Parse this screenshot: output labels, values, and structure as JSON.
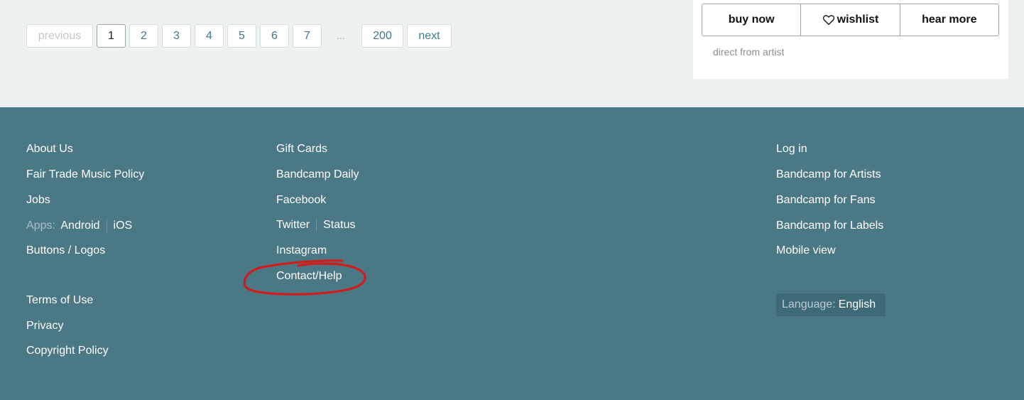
{
  "pagination": {
    "previous": "previous",
    "pages": [
      "1",
      "2",
      "3",
      "4",
      "5",
      "6",
      "7"
    ],
    "ellipsis": "...",
    "last": "200",
    "next": "next"
  },
  "purchase": {
    "buy_now": "buy now",
    "wishlist": "wishlist",
    "hear_more": "hear more",
    "direct": "direct from artist",
    "wishlist_icon": "heart-icon"
  },
  "footer": {
    "col1": {
      "about": "About Us",
      "fair_trade": "Fair Trade Music Policy",
      "jobs": "Jobs",
      "apps_label": "Apps:",
      "android": "Android",
      "ios": "iOS",
      "buttons_logos": "Buttons / Logos",
      "terms": "Terms of Use",
      "privacy": "Privacy",
      "copyright": "Copyright Policy"
    },
    "col2": {
      "gift_cards": "Gift Cards",
      "daily": "Bandcamp Daily",
      "facebook": "Facebook",
      "twitter": "Twitter",
      "status": "Status",
      "instagram": "Instagram",
      "contact": "Contact/Help"
    },
    "col3": {
      "login": "Log in",
      "for_artists": "Bandcamp for Artists",
      "for_fans": "Bandcamp for Fans",
      "for_labels": "Bandcamp for Labels",
      "mobile": "Mobile view",
      "language_label": "Language:",
      "language_value": "English"
    }
  },
  "colors": {
    "footer_bg": "#4a7885",
    "page_bg": "#eef1f2",
    "link_teal": "#3d7a8f",
    "annotation_red": "#d01c1c"
  }
}
